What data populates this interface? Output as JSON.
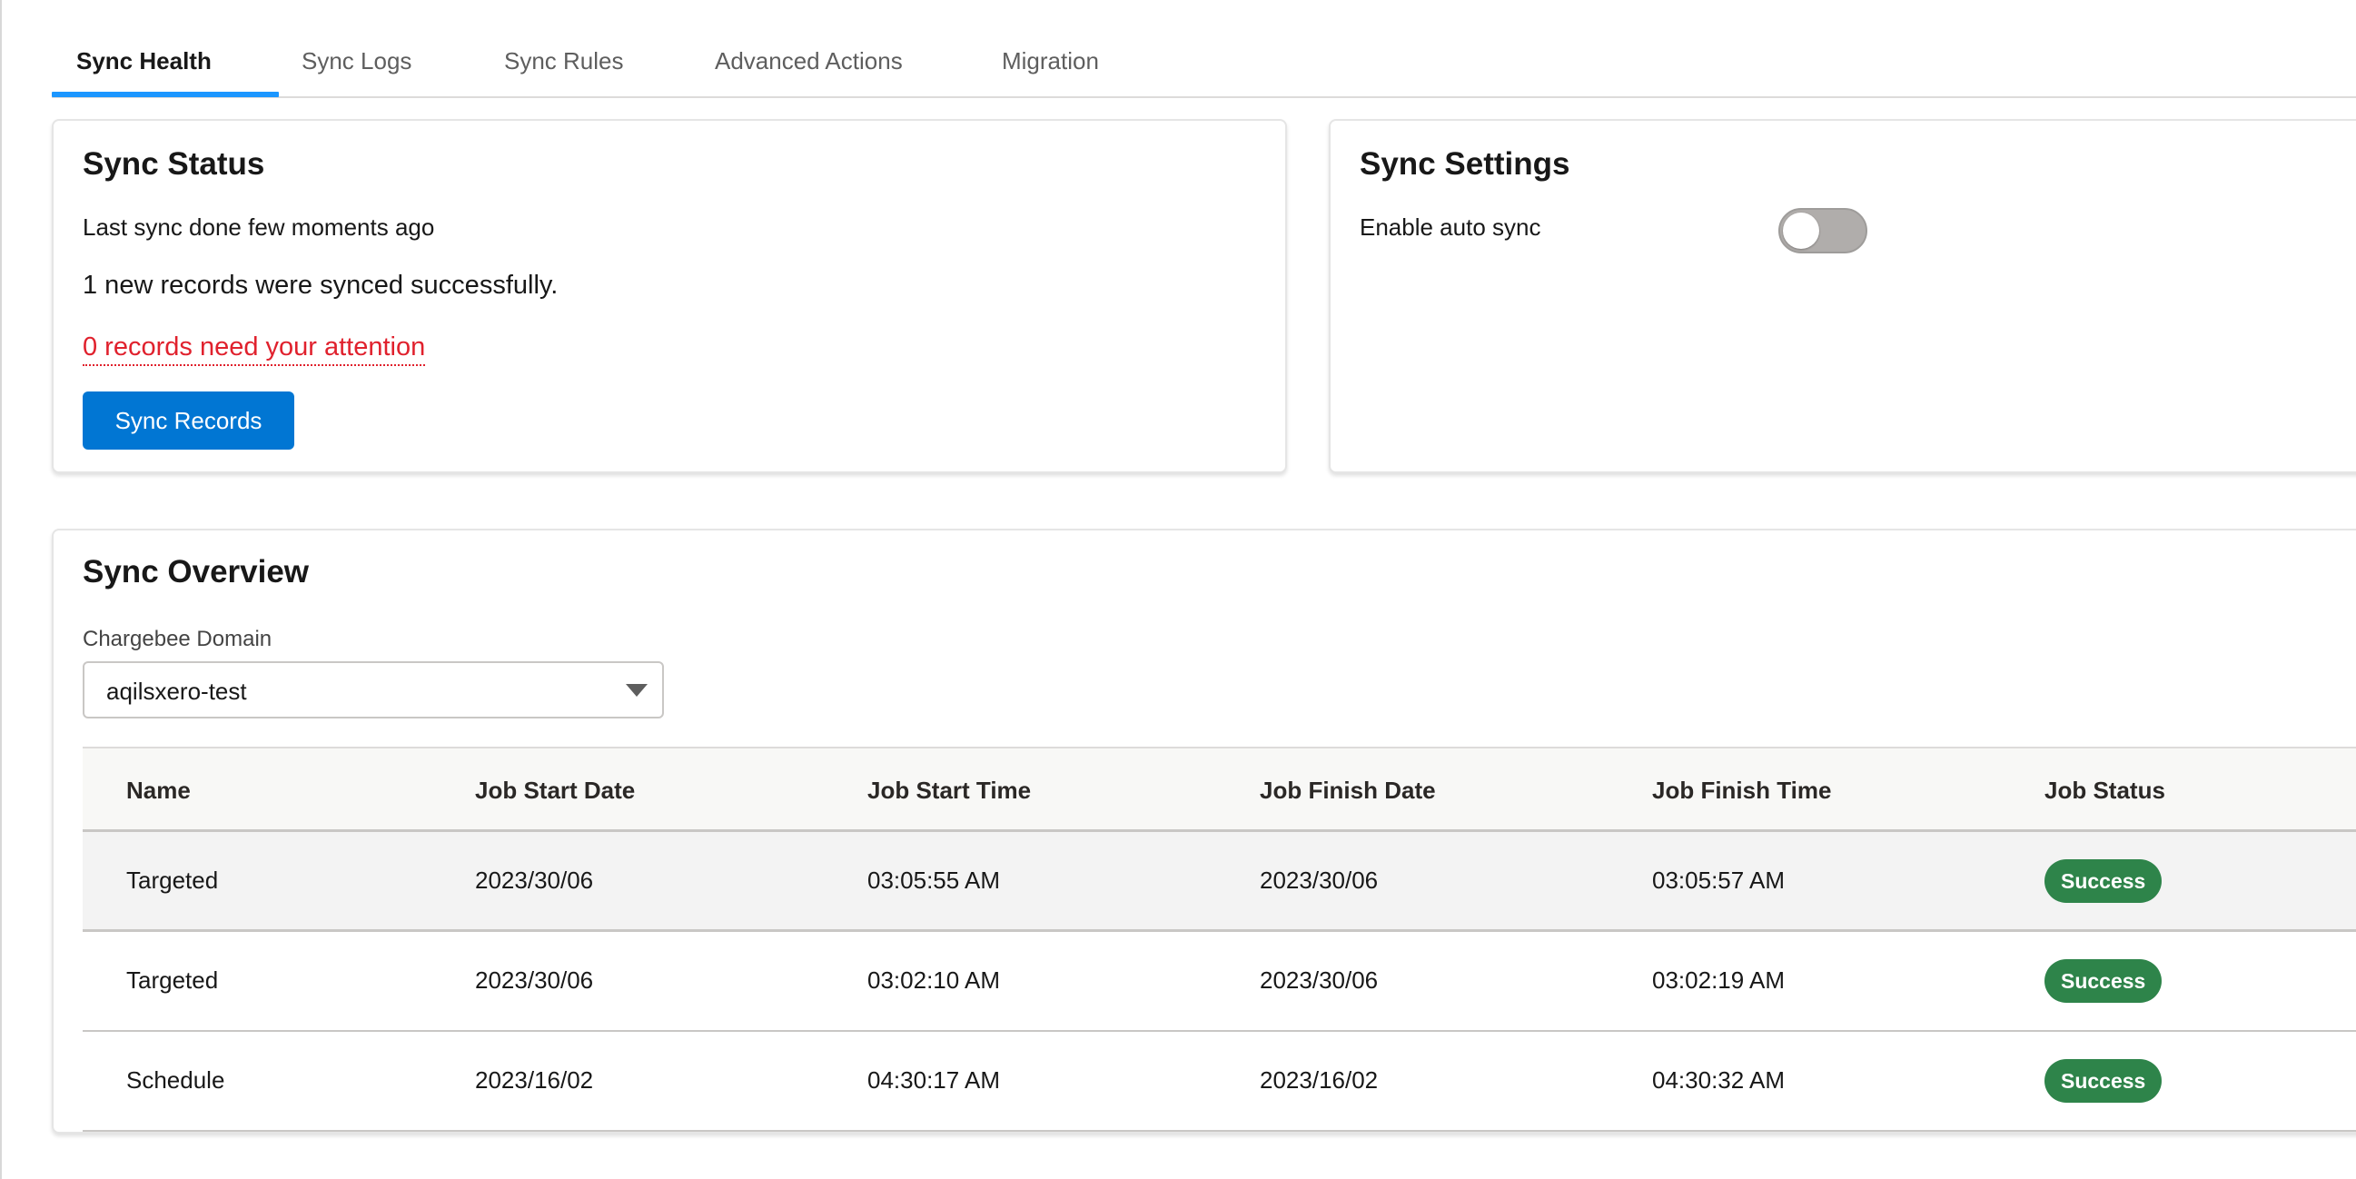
{
  "tabs": [
    {
      "label": "Sync Health",
      "active": true
    },
    {
      "label": "Sync Logs",
      "active": false
    },
    {
      "label": "Sync Rules",
      "active": false
    },
    {
      "label": "Advanced Actions",
      "active": false
    },
    {
      "label": "Migration",
      "active": false
    }
  ],
  "sync_status": {
    "title": "Sync Status",
    "last_sync": "Last sync done few moments ago",
    "records_synced": "1 new records were synced successfully.",
    "attention_link": "0 records need your attention",
    "sync_button": "Sync Records"
  },
  "sync_settings": {
    "title": "Sync Settings",
    "auto_sync_label": "Enable auto sync",
    "auto_sync_enabled": false
  },
  "sync_overview": {
    "title": "Sync Overview",
    "domain_label": "Chargebee Domain",
    "domain_value": "aqilsxero-test",
    "columns": [
      "Name",
      "Job Start Date",
      "Job Start Time",
      "Job Finish Date",
      "Job Finish Time",
      "Job Status"
    ],
    "rows": [
      [
        "Targeted",
        "2023/30/06",
        "03:05:55 AM",
        "2023/30/06",
        "03:05:57 AM",
        "Success"
      ],
      [
        "Targeted",
        "2023/30/06",
        "03:02:10 AM",
        "2023/30/06",
        "03:02:19 AM",
        "Success"
      ],
      [
        "Schedule",
        "2023/16/02",
        "04:30:17 AM",
        "2023/16/02",
        "04:30:32 AM",
        "Success"
      ]
    ]
  },
  "colors": {
    "accent": "#1b96ff",
    "primary_button": "#0176d3",
    "error_text": "#e0212d",
    "success_badge": "#2e844a"
  },
  "icons": {
    "domain_dropdown": "caret-down-icon"
  }
}
